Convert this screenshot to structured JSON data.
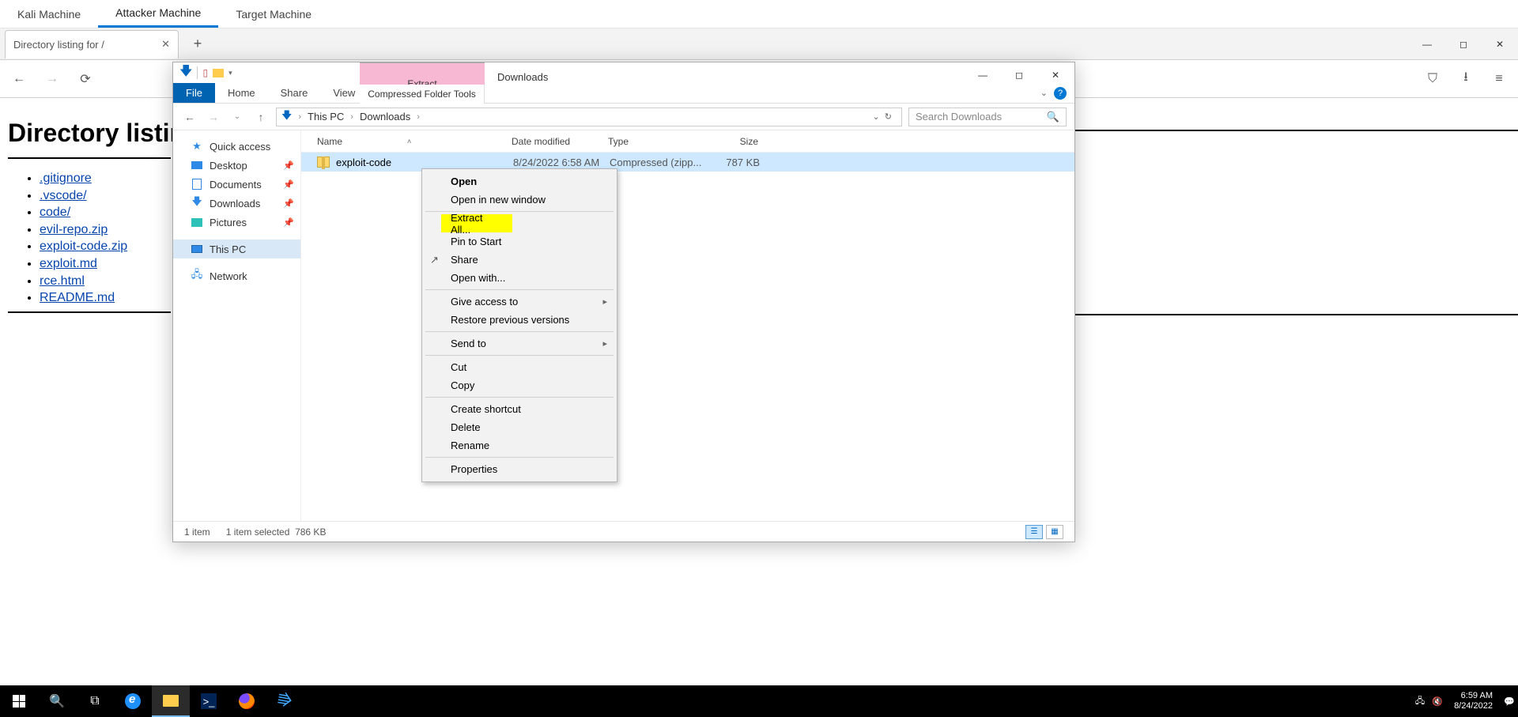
{
  "vmTabs": {
    "t0": "Kali Machine",
    "t1": "Attacker Machine",
    "t2": "Target Machine"
  },
  "browser": {
    "tabTitle": "Directory listing for /",
    "page": {
      "heading": "Directory listin",
      "links": {
        "l0": ".gitignore",
        "l1": ".vscode/",
        "l2": "code/",
        "l3": "evil-repo.zip",
        "l4": "exploit-code.zip",
        "l5": "exploit.md",
        "l6": "rce.html",
        "l7": "README.md"
      }
    }
  },
  "explorer": {
    "ctxTabTop": "Extract",
    "ctxTabBottom": "Compressed Folder Tools",
    "title": "Downloads",
    "ribbon": {
      "file": "File",
      "home": "Home",
      "share": "Share",
      "view": "View"
    },
    "path": {
      "p0": "This PC",
      "p1": "Downloads"
    },
    "searchPlaceholder": "Search Downloads",
    "tree": {
      "quick": "Quick access",
      "desktop": "Desktop",
      "documents": "Documents",
      "downloads": "Downloads",
      "pictures": "Pictures",
      "thispc": "This PC",
      "network": "Network"
    },
    "cols": {
      "name": "Name",
      "date": "Date modified",
      "type": "Type",
      "size": "Size"
    },
    "row": {
      "name": "exploit-code",
      "date": "8/24/2022 6:58 AM",
      "type": "Compressed (zipp...",
      "size": "787 KB"
    },
    "status": {
      "items": "1 item",
      "selected": "1 item selected",
      "size": "786 KB"
    }
  },
  "ctx": {
    "open": "Open",
    "openNew": "Open in new window",
    "extract": "Extract All...",
    "pin": "Pin to Start",
    "share": "Share",
    "openWith": "Open with...",
    "giveAccess": "Give access to",
    "restore": "Restore previous versions",
    "sendTo": "Send to",
    "cut": "Cut",
    "copy": "Copy",
    "shortcut": "Create shortcut",
    "delete": "Delete",
    "rename": "Rename",
    "properties": "Properties"
  },
  "taskbar": {
    "time": "6:59 AM",
    "date": "8/24/2022"
  }
}
